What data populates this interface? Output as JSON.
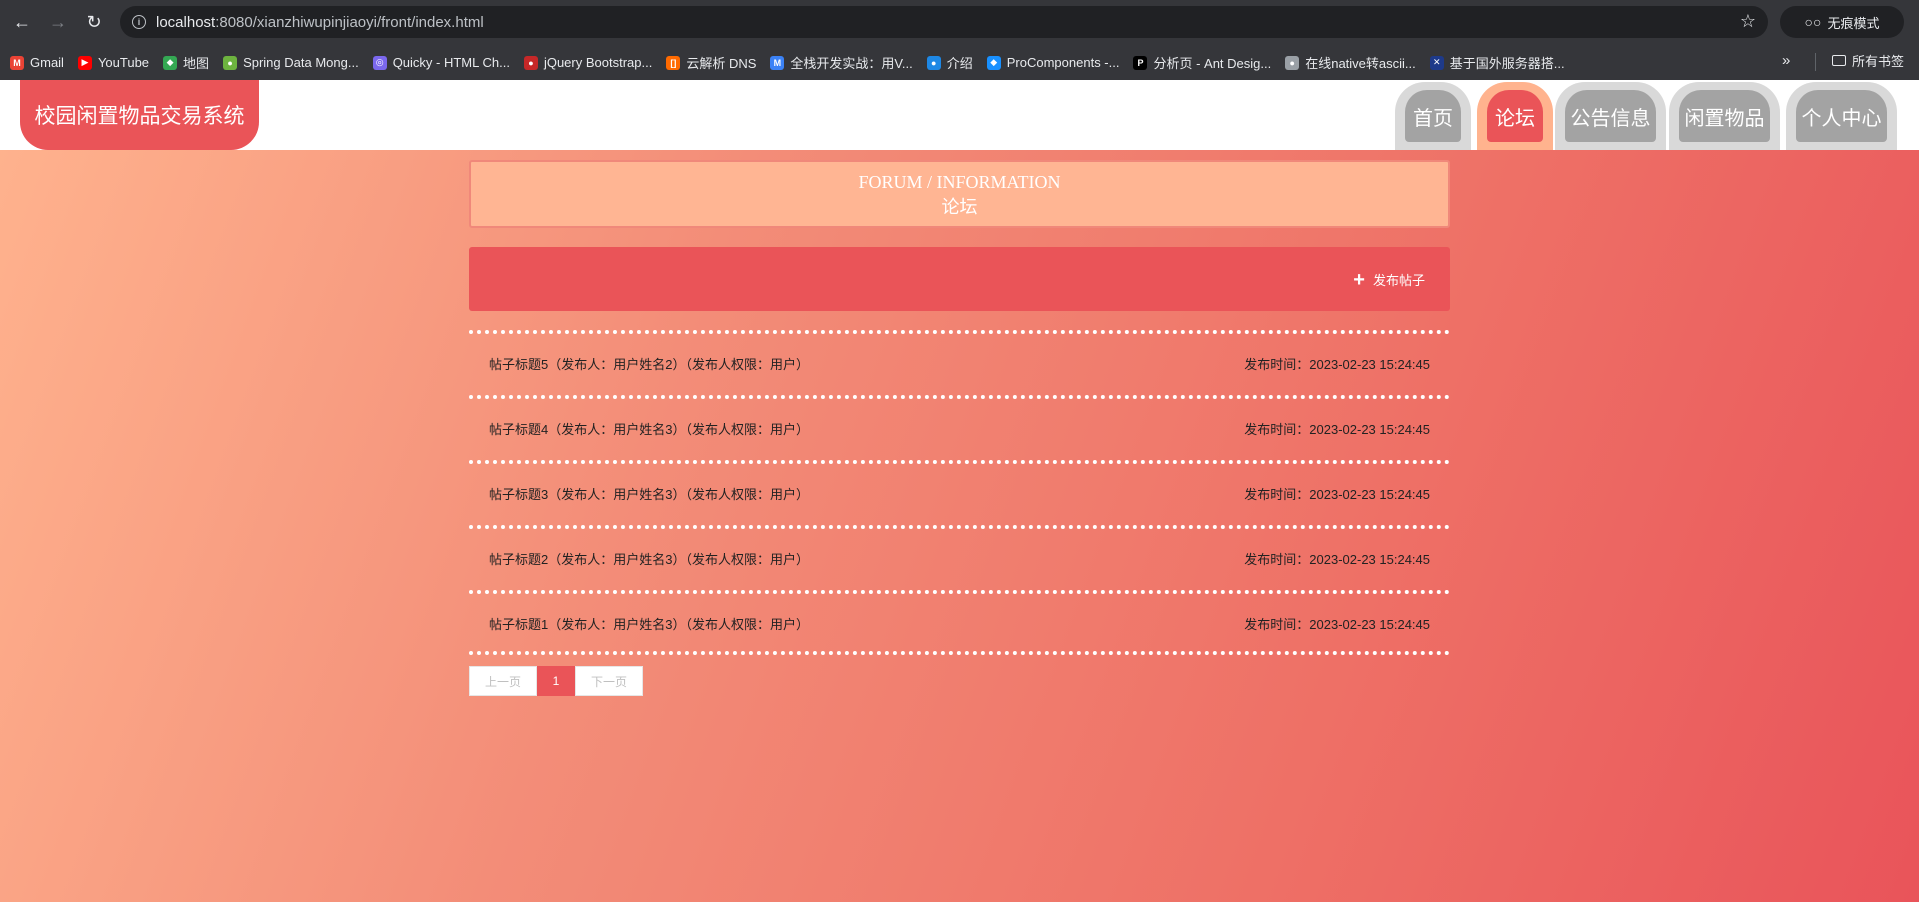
{
  "browser": {
    "url_host": "localhost",
    "url_rest": ":8080/xianzhiwupinjiaoyi/front/index.html",
    "incognito_label": "无痕模式",
    "all_bookmarks_label": "所有书签",
    "bookmarks": [
      {
        "label": "Gmail",
        "icon": "gmail-icon",
        "color": "#ea4335"
      },
      {
        "label": "YouTube",
        "icon": "youtube-icon",
        "color": "#ff0000"
      },
      {
        "label": "地图",
        "icon": "maps-icon",
        "color": "#34a853"
      },
      {
        "label": "Spring Data Mong...",
        "icon": "spring-icon",
        "color": "#6db33f"
      },
      {
        "label": "Quicky - HTML Ch...",
        "icon": "quicky-icon",
        "color": "#7b68ee"
      },
      {
        "label": "jQuery Bootstrap...",
        "icon": "jquery-icon",
        "color": "#c62828"
      },
      {
        "label": "云解析 DNS",
        "icon": "dns-icon",
        "color": "#ff6a00"
      },
      {
        "label": "全栈开发实战：用V...",
        "icon": "m-icon",
        "color": "#3b82f6"
      },
      {
        "label": "介绍",
        "icon": "intro-icon",
        "color": "#1e88e5"
      },
      {
        "label": "ProComponents -...",
        "icon": "procomponents-icon",
        "color": "#1890ff"
      },
      {
        "label": "分析页 - Ant Desig...",
        "icon": "pro-icon",
        "color": "#000000"
      },
      {
        "label": "在线native转ascii...",
        "icon": "globe-icon",
        "color": "#9aa0a6"
      },
      {
        "label": "基于国外服务器搭...",
        "icon": "flag-icon",
        "color": "#1e3a8a"
      }
    ]
  },
  "site": {
    "logo": "校园闲置物品交易系统",
    "nav": [
      {
        "label": "首页",
        "active": false
      },
      {
        "label": "论坛",
        "active": true
      },
      {
        "label": "公告信息",
        "active": false
      },
      {
        "label": "闲置物品",
        "active": false
      },
      {
        "label": "个人中心",
        "active": false
      }
    ]
  },
  "forum": {
    "title_en": "FORUM / INFORMATION",
    "title_zh": "论坛",
    "publish_label": "发布帖子",
    "posts": [
      {
        "title": "帖子标题5（发布人：用户姓名2）（发布人权限：用户）",
        "time": "发布时间：2023-02-23 15:24:45"
      },
      {
        "title": "帖子标题4（发布人：用户姓名3）（发布人权限：用户）",
        "time": "发布时间：2023-02-23 15:24:45"
      },
      {
        "title": "帖子标题3（发布人：用户姓名3）（发布人权限：用户）",
        "time": "发布时间：2023-02-23 15:24:45"
      },
      {
        "title": "帖子标题2（发布人：用户姓名3）（发布人权限：用户）",
        "time": "发布时间：2023-02-23 15:24:45"
      },
      {
        "title": "帖子标题1（发布人：用户姓名3）（发布人权限：用户）",
        "time": "发布时间：2023-02-23 15:24:45"
      }
    ],
    "pager": {
      "prev": "上一页",
      "current": "1",
      "next": "下一页"
    }
  },
  "colors": {
    "accent": "#ea5458",
    "title_panel": "#ffb593",
    "nav_inactive": "#a3a3a3"
  }
}
